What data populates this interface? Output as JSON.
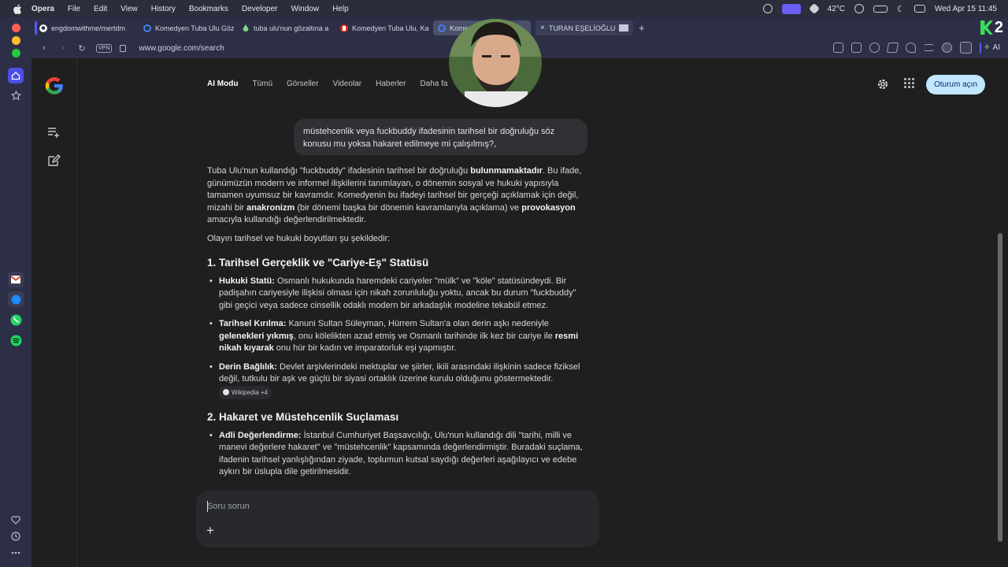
{
  "menubar": {
    "items": [
      "Opera",
      "File",
      "Edit",
      "View",
      "History",
      "Bookmarks",
      "Developer",
      "Window",
      "Help"
    ],
    "temperature": "42°C",
    "datetime": "Wed Apr 15  11:45"
  },
  "tabs": [
    {
      "label": "engdomwithme/mertdm",
      "favicon": "github-icon",
      "color": "#ffffff"
    },
    {
      "label": "Komedyen Tuba Ulu Göz",
      "favicon": "google-icon",
      "color": "#4285f4"
    },
    {
      "label": "tuba ulu'nun gözaltına a",
      "favicon": "drop-icon",
      "color": "#7dd87d"
    },
    {
      "label": "Komedyen Tuba Ulu, Ka",
      "favicon": "b-icon",
      "color": "#d93025"
    },
    {
      "label": "Kome",
      "favicon": "google-icon",
      "color": "#4285f4"
    },
    {
      "label": "TURAN EŞELİOĞLU",
      "favicon": "close-icon",
      "color": "#c8cadb"
    }
  ],
  "new_tab_symbol": "+",
  "k2_logo": "2",
  "address": {
    "vpn": "VPN",
    "url": "www.google.com/search",
    "ai_label": "AI"
  },
  "google": {
    "nav": [
      "AI Modu",
      "Tümü",
      "Görseller",
      "Videolar",
      "Haberler",
      "Daha fa"
    ],
    "signin": "Oturum açın",
    "query": "müstehcenlik veya fuckbuddy ifadesinin tarihsel bir doğruluğu söz konusu mu yoksa hakaret edilmeye mi çalışılmış?,",
    "intro": {
      "t1": "Tuba Ulu'nun kullandığı \"fuckbuddy\" ifadesinin tarihsel bir doğruluğu ",
      "b1": "bulunmamaktadır",
      "t2": ". Bu ifade, günümüzün modern ve informel ilişkilerini tanımlayan, o dönemin sosyal ve hukuki yapısıyla tamamen uyumsuz bir kavramdır. Komedyenin bu ifadeyi tarihsel bir gerçeği açıklamak için değil, mizahi bir ",
      "b2": "anakronizm",
      "t3": " (bir dönemi başka bir dönemin kavramlarıyla açıklama) ve ",
      "b3": "provokasyon",
      "t4": " amacıyla kullandığı değerlendirilmektedir."
    },
    "lead": "Olayın tarihsel ve hukuki boyutları şu şekildedir:",
    "section1": {
      "heading": "1. Tarihsel Gerçeklik ve \"Cariye-Eş\" Statüsü",
      "bullet1_title": "Hukuki Statü:",
      "bullet1_text": " Osmanlı hukukunda haremdeki cariyeler \"mülk\" ve \"köle\" statüsündeydi. Bir padişahın cariyesiyle ilişkisi olması için nikah zorunluluğu yoktu, ancak bu durum \"fuckbuddy\" gibi geçici veya sadece cinsellik odaklı modern bir arkadaşlık modeline tekabül etmez.",
      "bullet2_title": "Tarihsel Kırılma:",
      "bullet2_t1": " Kanuni Sultan Süleyman, Hürrem Sultan'a olan derin aşkı nedeniyle ",
      "bullet2_b1": "gelenekleri yıkmış",
      "bullet2_t2": ", onu kölelikten azad etmiş ve Osmanlı tarihinde ilk kez bir cariye ile ",
      "bullet2_b2": "resmi nikah kıyarak",
      "bullet2_t3": " onu hür bir kadın ve imparatorluk eşi yapmıştır.",
      "bullet3_title": "Derin Bağlılık:",
      "bullet3_text": " Devlet arşivlerindeki mektuplar ve şiirler, ikili arasındaki ilişkinin sadece fiziksel değil, tutkulu bir aşk ve güçlü bir siyasi ortaklık üzerine kurulu olduğunu göstermektedir.",
      "chip": "Wikipedia +4"
    },
    "section2": {
      "heading": "2. Hakaret ve Müstehcenlik Suçlaması",
      "bullet1_title": "Adli Değerlendirme:",
      "bullet1_text": " İstanbul Cumhuriyet Başsavcılığı, Ulu'nun kullandığı dili \"tarihi, milli ve manevi değerlere hakaret\" ve \"müstehcenlik\" kapsamında değerlendirmiştir. Buradaki suçlama, ifadenin tarihsel yanlışlığından ziyade, toplumun kutsal saydığı değerleri aşağılayıcı ve edebe aykırı bir üslupla dile getirilmesidir."
    },
    "ask_placeholder": "Soru sorun",
    "ask_plus": "+"
  },
  "colors": {
    "accent_opera": "#5b5cf0",
    "signin_bg": "#c2e7ff",
    "page_bg": "#1f1f1f"
  }
}
